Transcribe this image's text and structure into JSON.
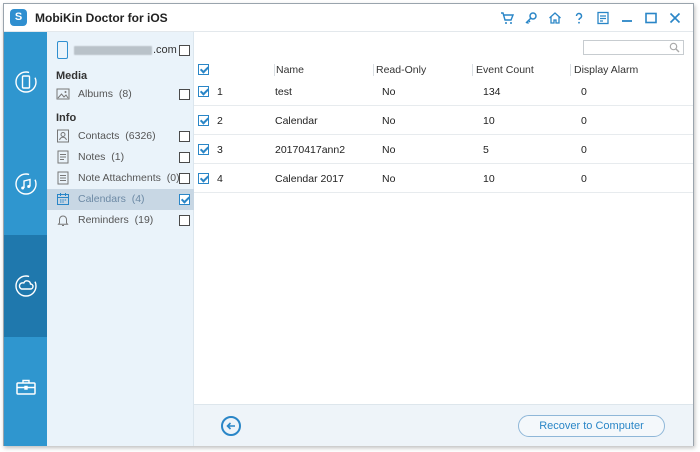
{
  "app": {
    "title": "MobiKin Doctor for iOS",
    "logo_letter": "S"
  },
  "titlebar_icons": [
    "cart-icon",
    "key-icon",
    "home-icon",
    "help-icon",
    "feedback-icon",
    "minimize-icon",
    "maximize-icon",
    "close-icon"
  ],
  "rail": {
    "items": [
      {
        "name": "recover-from-device-icon",
        "active": false
      },
      {
        "name": "recover-from-itunes-icon",
        "active": false
      },
      {
        "name": "recover-from-icloud-icon",
        "active": true
      },
      {
        "name": "toolkit-icon",
        "active": false
      }
    ]
  },
  "device": {
    "name_suffix": ".com",
    "checked": false
  },
  "sidebar": {
    "media_title": "Media",
    "info_title": "Info",
    "media_items": [
      {
        "label": "Albums",
        "count": "(8)",
        "checked": false,
        "icon": "album-icon"
      }
    ],
    "info_items": [
      {
        "label": "Contacts",
        "count": "(6326)",
        "checked": false,
        "icon": "contacts-icon"
      },
      {
        "label": "Notes",
        "count": "(1)",
        "checked": false,
        "icon": "notes-icon"
      },
      {
        "label": "Note Attachments",
        "count": "(0)",
        "checked": false,
        "icon": "note-attachments-icon"
      },
      {
        "label": "Calendars",
        "count": "(4)",
        "checked": true,
        "icon": "calendar-icon",
        "selected": true
      },
      {
        "label": "Reminders",
        "count": "(19)",
        "checked": false,
        "icon": "bell-icon"
      }
    ]
  },
  "table": {
    "select_all_checked": true,
    "columns": [
      "Name",
      "Read-Only",
      "Event Count",
      "Display Alarm"
    ],
    "rows": [
      {
        "index": "1",
        "name": "test",
        "read_only": "No",
        "event_count": "134",
        "display_alarm": "0",
        "checked": true
      },
      {
        "index": "2",
        "name": "Calendar",
        "read_only": "No",
        "event_count": "10",
        "display_alarm": "0",
        "checked": true
      },
      {
        "index": "3",
        "name": "20170417ann2",
        "read_only": "No",
        "event_count": "5",
        "display_alarm": "0",
        "checked": true
      },
      {
        "index": "4",
        "name": "Calendar 2017",
        "read_only": "No",
        "event_count": "10",
        "display_alarm": "0",
        "checked": true
      }
    ]
  },
  "search": {
    "placeholder": ""
  },
  "footer": {
    "recover_label": "Recover to Computer"
  },
  "colors": {
    "accent": "#2a86c7",
    "rail": "#2f96cf",
    "rail_active": "#1f78ad",
    "sidebar_bg": "#eaf3fa"
  }
}
